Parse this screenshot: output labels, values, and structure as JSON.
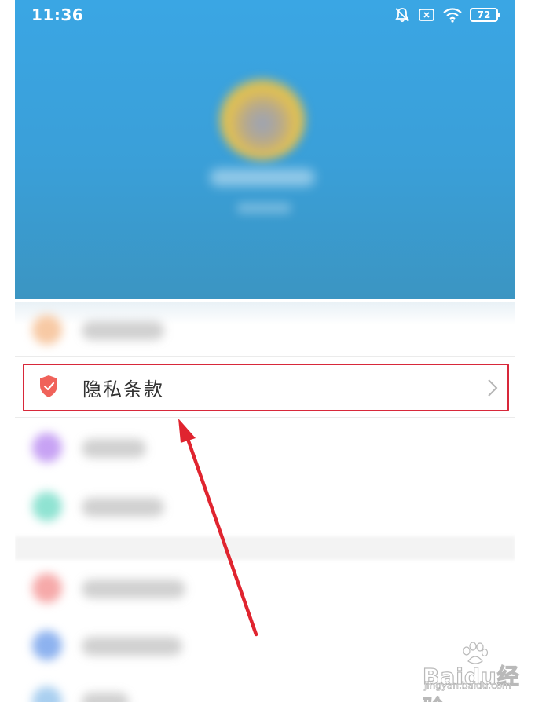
{
  "status_bar": {
    "time": "11:36",
    "battery": "72"
  },
  "menu": {
    "privacy_item": {
      "label": "隐私条款"
    }
  },
  "icons": {
    "privacy": "shield-check-icon",
    "chevron": "chevron-right-icon",
    "bell": "bell-off-icon",
    "sim": "sim-cross-icon",
    "wifi": "wifi-icon"
  },
  "colors": {
    "header": "#3aa6e4",
    "shield": "#f0625a",
    "highlight": "#d8283a",
    "arrow": "#e0242f"
  },
  "watermark": {
    "logo": "Baidu经验",
    "url": "jingyan.baidu.com"
  }
}
